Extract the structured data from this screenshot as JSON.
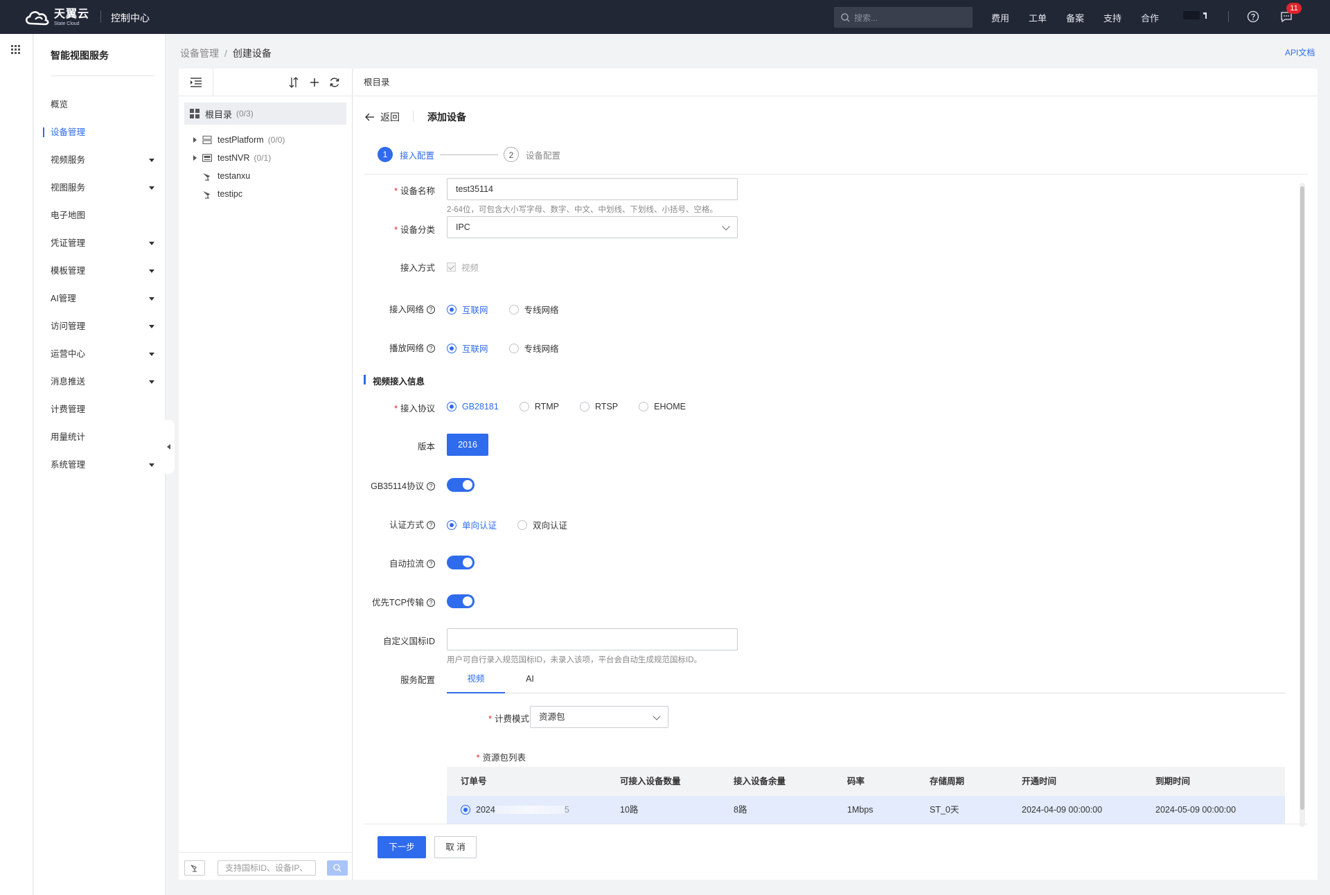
{
  "topbar": {
    "brand_cn": "天翼云",
    "brand_en": "State Cloud",
    "console": "控制中心",
    "search_placeholder": "搜索...",
    "nav": [
      "费用",
      "工单",
      "备案",
      "支持",
      "合作"
    ],
    "badge_count": "11"
  },
  "sidebar": {
    "title": "智能视图服务",
    "items": [
      {
        "label": "概览",
        "expandable": false,
        "active": false
      },
      {
        "label": "设备管理",
        "expandable": false,
        "active": true
      },
      {
        "label": "视频服务",
        "expandable": true,
        "active": false
      },
      {
        "label": "视图服务",
        "expandable": true,
        "active": false
      },
      {
        "label": "电子地图",
        "expandable": false,
        "active": false
      },
      {
        "label": "凭证管理",
        "expandable": true,
        "active": false
      },
      {
        "label": "模板管理",
        "expandable": true,
        "active": false
      },
      {
        "label": "AI管理",
        "expandable": true,
        "active": false
      },
      {
        "label": "访问管理",
        "expandable": true,
        "active": false
      },
      {
        "label": "运营中心",
        "expandable": true,
        "active": false
      },
      {
        "label": "消息推送",
        "expandable": true,
        "active": false
      },
      {
        "label": "计费管理",
        "expandable": false,
        "active": false
      },
      {
        "label": "用量统计",
        "expandable": false,
        "active": false
      },
      {
        "label": "系统管理",
        "expandable": true,
        "active": false
      }
    ]
  },
  "breadcrumb": {
    "parent": "设备管理",
    "separator": "/",
    "current": "创建设备"
  },
  "api_doc": "API文档",
  "tree": {
    "root": {
      "label": "根目录",
      "count": "(0/3)"
    },
    "nodes": [
      {
        "label": "testPlatform",
        "count": "(0/0)",
        "icon": "server-icon",
        "expandable": true
      },
      {
        "label": "testNVR",
        "count": "(0/1)",
        "icon": "nvr-icon",
        "expandable": true
      },
      {
        "label": "testanxu",
        "count": "",
        "icon": "camera-icon",
        "expandable": false
      },
      {
        "label": "testipc",
        "count": "",
        "icon": "camera-icon",
        "expandable": false
      }
    ],
    "search_placeholder": "支持国标ID、设备IP、"
  },
  "main": {
    "header": "根目录",
    "back": "返回",
    "title": "添加设备",
    "steps": [
      {
        "num": "1",
        "label": "接入配置",
        "active": true
      },
      {
        "num": "2",
        "label": "设备配置",
        "active": false
      }
    ]
  },
  "form": {
    "device_name": {
      "label": "设备名称",
      "value": "test35114",
      "hint": "2-64位，可包含大小写字母、数字、中文、中划线、下划线、小括号、空格。"
    },
    "device_category": {
      "label": "设备分类",
      "value": "IPC"
    },
    "access_mode": {
      "label": "接入方式",
      "option": "视频"
    },
    "access_network": {
      "label": "接入网络",
      "options": [
        "互联网",
        "专线网络"
      ],
      "selected": 0
    },
    "play_network": {
      "label": "播放网络",
      "options": [
        "互联网",
        "专线网络"
      ],
      "selected": 0
    },
    "section_video": "视频接入信息",
    "protocol": {
      "label": "接入协议",
      "options": [
        "GB28181",
        "RTMP",
        "RTSP",
        "EHOME"
      ],
      "selected": 0
    },
    "version": {
      "label": "版本",
      "value": "2016"
    },
    "gb35114": {
      "label": "GB35114协议",
      "on": true
    },
    "auth": {
      "label": "认证方式",
      "options": [
        "单向认证",
        "双向认证"
      ],
      "selected": 0
    },
    "auto_pull": {
      "label": "自动拉流",
      "on": true
    },
    "tcp_first": {
      "label": "优先TCP传输",
      "on": true
    },
    "custom_id": {
      "label": "自定义国标ID",
      "value": "",
      "hint": "用户可自行录入规范国标ID，未录入该项，平台会自动生成规范国标ID。"
    },
    "service_config": {
      "label": "服务配置",
      "tabs": [
        "视频",
        "AI"
      ],
      "active_tab": 0
    },
    "billing_mode": {
      "label": "计费模式",
      "value": "资源包"
    },
    "package_list": {
      "label": "资源包列表",
      "columns": [
        "订单号",
        "可接入设备数量",
        "接入设备余量",
        "码率",
        "存储周期",
        "开通时间",
        "到期时间"
      ],
      "rows": [
        {
          "order": "2024",
          "order_tail": "5",
          "capacity": "10路",
          "remaining": "8路",
          "bitrate": "1Mbps",
          "storage": "ST_0天",
          "start": "2024-04-09 00:00:00",
          "end": "2024-05-09 00:00:00"
        }
      ]
    }
  },
  "buttons": {
    "next": "下一步",
    "cancel": "取 消"
  },
  "colors": {
    "primary": "#2f6bed",
    "topbar": "#222736",
    "badge": "#e0242c"
  }
}
